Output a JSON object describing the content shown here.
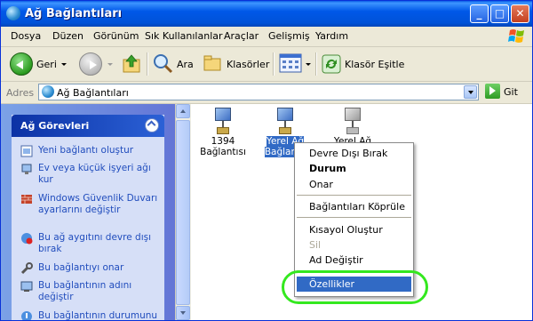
{
  "window": {
    "title": "Ağ Bağlantıları",
    "controls": {
      "minimize": "_",
      "maximize": "□",
      "close": "✕"
    }
  },
  "menubar": {
    "items": [
      "Dosya",
      "Düzen",
      "Görünüm",
      "Sık Kullanılanlar",
      "Araçlar",
      "Gelişmiş",
      "Yardım"
    ]
  },
  "toolbar": {
    "back_label": "Geri",
    "search_label": "Ara",
    "folders_label": "Klasörler",
    "sync_label": "Klasör Eşitle"
  },
  "address": {
    "label": "Adres",
    "value": "Ağ Bağlantıları",
    "go_label": "Git"
  },
  "tasks": {
    "title": "Ağ Görevleri",
    "items": [
      "Yeni bağlantı oluştur",
      "Ev veya küçük işyeri ağı kur",
      "Windows Güvenlik Duvarı ayarlarını değiştir",
      "Bu ağ aygıtını devre dışı bırak",
      "Bu bağlantıyı onar",
      "Bu bağlantının adını değiştir",
      "Bu bağlantının durumunu görüntüle"
    ]
  },
  "connections": [
    {
      "label_line1": "1394",
      "label_line2": "Bağlantısı"
    },
    {
      "label_line1": "Yerel Ağ",
      "label_line2": "Bağlan..."
    },
    {
      "label_line1": "Yerel Ağ",
      "label_line2": ""
    }
  ],
  "context_menu": {
    "items": {
      "disable": "Devre Dışı Bırak",
      "status": "Durum",
      "repair": "Onar",
      "bridge": "Bağlantıları Köprüle",
      "shortcut": "Kısayol Oluştur",
      "delete": "Sil",
      "rename": "Ad Değiştir",
      "properties": "Özellikler"
    },
    "highlight_color": "#316ac5",
    "annotation_color": "#34e81f"
  }
}
